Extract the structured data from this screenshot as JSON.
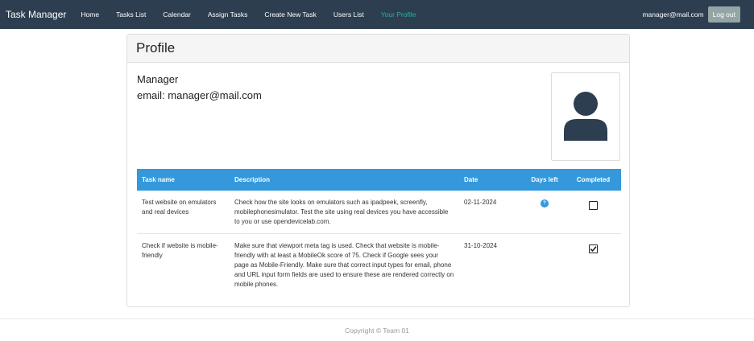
{
  "navbar": {
    "brand": "Task Manager",
    "links": [
      {
        "label": "Home"
      },
      {
        "label": "Tasks List"
      },
      {
        "label": "Calendar"
      },
      {
        "label": "Assign Tasks"
      },
      {
        "label": "Create New Task"
      },
      {
        "label": "Users List"
      },
      {
        "label": "Your Profile"
      }
    ],
    "active_link": "Your Profile",
    "user_email": "manager@mail.com",
    "logout_label": "Log out"
  },
  "profile": {
    "title": "Profile",
    "role": "Manager",
    "email_line": "email: manager@mail.com",
    "avatar_icon": "user-icon"
  },
  "tasks": {
    "headers": {
      "name": "Task name",
      "description": "Description",
      "date": "Date",
      "days_left": "Days left",
      "completed": "Completed"
    },
    "rows": [
      {
        "name": "Test website on emulators and real devices",
        "description": "Check how the site looks on emulators such as ipadpeek, screenfly, mobilephonesimulator. Test the site using real devices you have accessible to you or use opendevicelab.com.",
        "date": "02-11-2024",
        "days_left": "?",
        "completed": false
      },
      {
        "name": "Check if website is mobile-friendly",
        "description": "Make sure that viewport meta tag is used. Check that website is mobile-friendly with at least a MobileOk score of 75. Check if Google sees your page as Mobile-Friendly. Make sure that correct input types for email, phone and URL input form fields are used to ensure these are rendered correctly on mobile phones.",
        "date": "31-10-2024",
        "days_left": "",
        "completed": true
      }
    ]
  },
  "footer": {
    "text": "Copyright ©  Team 01"
  },
  "colors": {
    "navbar_bg": "#2c3e50",
    "active_link": "#18bc9c",
    "table_header_bg": "#3498db",
    "logout_bg": "#95a5a6",
    "avatar_fill": "#2c3e50"
  }
}
